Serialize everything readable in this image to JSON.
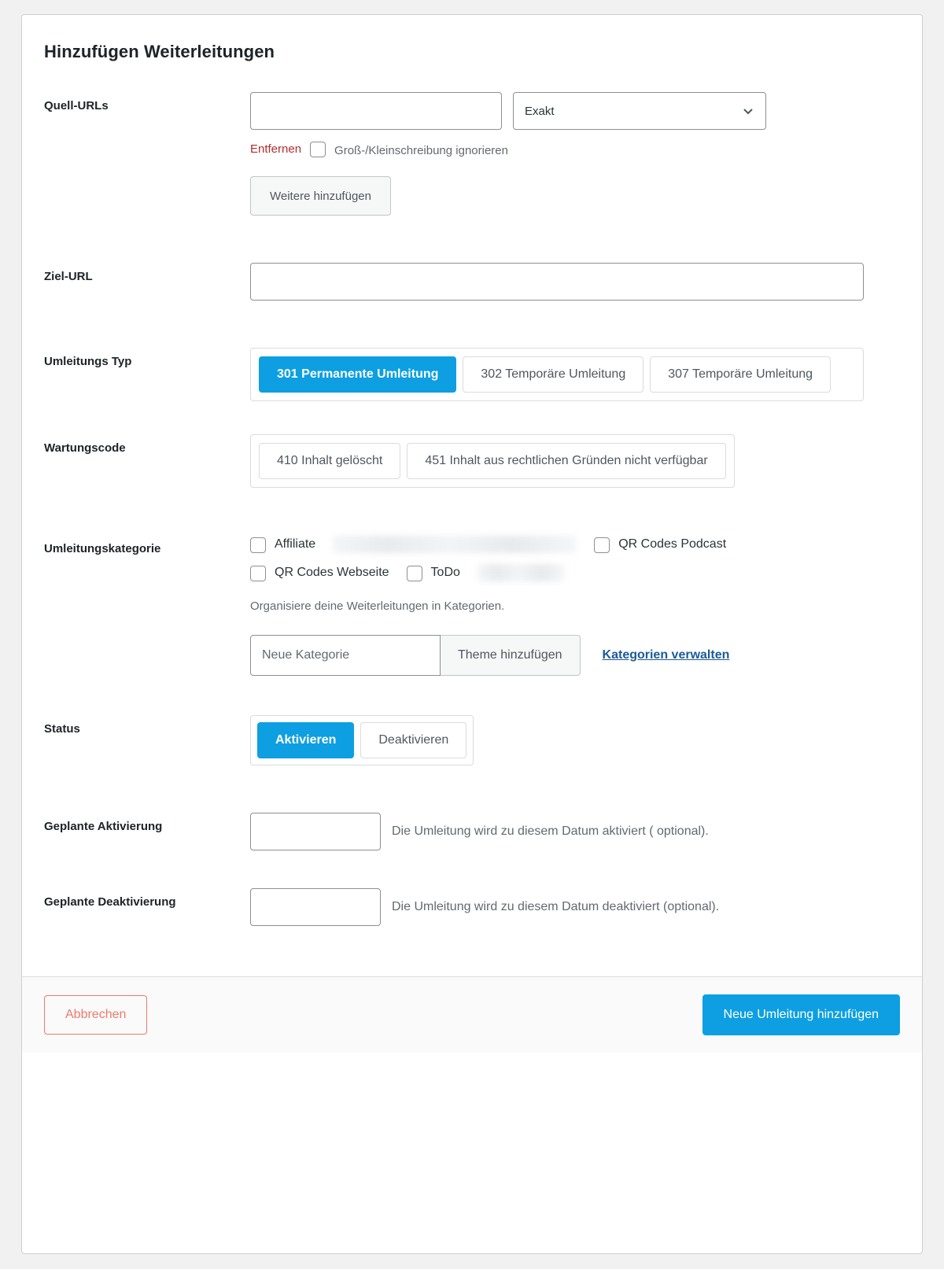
{
  "form": {
    "title": "Hinzufügen Weiterleitungen"
  },
  "source_urls": {
    "label": "Quell-URLs",
    "input_value": "",
    "input_placeholder": "",
    "match_select_value": "Exakt",
    "chevron_icon": "chevron-down-icon",
    "remove_link": "Entfernen",
    "ignore_case_label": "Groß-/Kleinschreibung ignorieren",
    "ignore_case_checked": false,
    "add_more_button": "Weitere hinzufügen"
  },
  "target_url": {
    "label": "Ziel-URL",
    "input_value": "",
    "input_placeholder": ""
  },
  "redirect_type": {
    "label": "Umleitungs Typ",
    "options": [
      {
        "label": "301 Permanente Umleitung",
        "selected": true
      },
      {
        "label": "302 Temporäre Umleitung",
        "selected": false
      },
      {
        "label": "307 Temporäre Umleitung",
        "selected": false
      }
    ]
  },
  "maintenance_code": {
    "label": "Wartungscode",
    "options": [
      {
        "label": "410 Inhalt gelöscht",
        "selected": false
      },
      {
        "label": "451 Inhalt aus rechtlichen Gründen nicht verfügbar",
        "selected": false
      }
    ]
  },
  "category": {
    "label": "Umleitungskategorie",
    "items": [
      {
        "label": "Affiliate",
        "checked": false,
        "redacted": false
      },
      {
        "label": "",
        "checked": false,
        "redacted": true
      },
      {
        "label": "QR Codes Podcast",
        "checked": false,
        "redacted": false
      },
      {
        "label": "QR Codes Webseite",
        "checked": false,
        "redacted": false
      },
      {
        "label": "ToDo",
        "checked": false,
        "redacted": false
      },
      {
        "label": "",
        "checked": false,
        "redacted": true
      }
    ],
    "help_text": "Organisiere deine Weiterleitungen in Kategorien.",
    "new_category_placeholder": "Neue Kategorie",
    "new_category_value": "",
    "add_theme_button": "Theme hinzufügen",
    "manage_link": "Kategorien verwalten"
  },
  "status": {
    "label": "Status",
    "options": [
      {
        "label": "Aktivieren",
        "selected": true
      },
      {
        "label": "Deaktivieren",
        "selected": false
      }
    ]
  },
  "scheduled_activation": {
    "label": "Geplante Aktivierung",
    "input_value": "",
    "input_placeholder": "",
    "note": "Die Umleitung wird zu diesem Datum aktiviert ( optional)."
  },
  "scheduled_deactivation": {
    "label": "Geplante Deaktivierung",
    "input_value": "",
    "input_placeholder": "",
    "note": "Die Umleitung wird zu diesem Datum deaktiviert (optional)."
  },
  "footer": {
    "cancel_label": "Abbrechen",
    "submit_label": "Neue Umleitung hinzufügen"
  },
  "colors": {
    "accent_blue": "#0d9fe1",
    "danger_red": "#b32d2e",
    "cancel_red": "#f0796b",
    "link_blue": "#1d5a96",
    "page_bg": "#f1f1f1"
  }
}
